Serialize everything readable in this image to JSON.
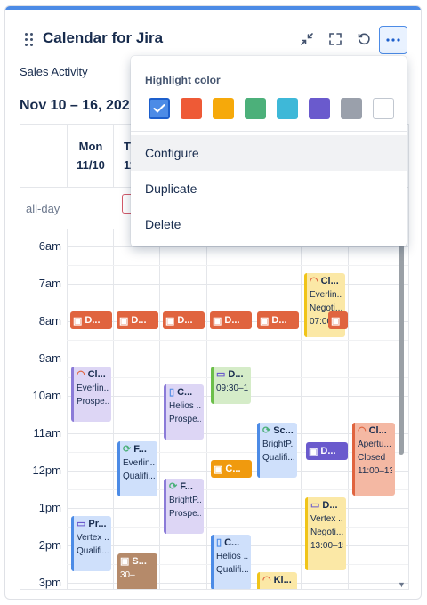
{
  "gadget": {
    "title": "Calendar for Jira",
    "subtitle": "Sales Activity",
    "date_range": "Nov 10 – 16, 202",
    "header_icons": [
      "collapse-icon",
      "fullscreen-icon",
      "refresh-icon",
      "more-options-icon"
    ]
  },
  "calendar": {
    "days": [
      {
        "name": "Mon",
        "date": "11/10"
      },
      {
        "name": "T",
        "date": "11"
      }
    ],
    "allday_label": "all-day",
    "times": [
      "6am",
      "7am",
      "8am",
      "9am",
      "10am",
      "11am",
      "12pm",
      "1pm",
      "2pm",
      "3pm"
    ],
    "timed_bar_label": "D...",
    "events": {
      "e1": {
        "title": "Cl...",
        "line1": "Everlin...",
        "line2": "Prospe..."
      },
      "e2": {
        "title": "F...",
        "line1": "Everlin...",
        "line2": "Qualifi..."
      },
      "e3": {
        "title": "Pr...",
        "line1": "Vertex ...",
        "line2": "Qualifi..."
      },
      "e4": {
        "title": "S...",
        "line1": "30–"
      },
      "e5": {
        "title": "C...",
        "line1": "Helios ...",
        "line2": "Prospe..."
      },
      "e6": {
        "title": "F...",
        "line1": "BrightP...",
        "line2": "Prospe..."
      },
      "e7": {
        "title": "D...",
        "line1": "09:30–10"
      },
      "e8": {
        "title": "C..."
      },
      "e9": {
        "title": "C...",
        "line1": "Helios ...",
        "line2": "Qualifi..."
      },
      "e10": {
        "title": "Sc...",
        "line1": "BrightP...",
        "line2": "Qualifi..."
      },
      "e11": {
        "title": "Ki..."
      },
      "e12": {
        "title": "Cl...",
        "line1": "Everlin...",
        "line2": "Negoti...",
        "line3": "07:00–0"
      },
      "e13": {
        "title": "D..."
      },
      "e14": {
        "title": "D...",
        "line1": "Vertex ...",
        "line2": "Negoti...",
        "line3": "13:00–15"
      },
      "e15": {
        "title": "Cl...",
        "line1": "Apertu...",
        "line2": "Closed",
        "line3": "11:00–13"
      }
    }
  },
  "menu": {
    "highlight_label": "Highlight color",
    "swatches": [
      "#4c8be6",
      "#ee5a36",
      "#f6a90a",
      "#4cb07a",
      "#3eb8d8",
      "#6a5acd",
      "#9aa0ab",
      "#ffffff"
    ],
    "selected_swatch": 0,
    "items": [
      "Configure",
      "Duplicate",
      "Delete"
    ]
  },
  "colors": {
    "accent": "#4c8be6",
    "orange": "#e0643f",
    "purple_bg": "#ddd6f5",
    "blue_bg": "#cfe0fb",
    "yellow_bg": "#fbe8a6",
    "salmon_bg": "#f4b8a3",
    "green_bg": "#d5ecc8",
    "brown": "#b58a6a"
  }
}
